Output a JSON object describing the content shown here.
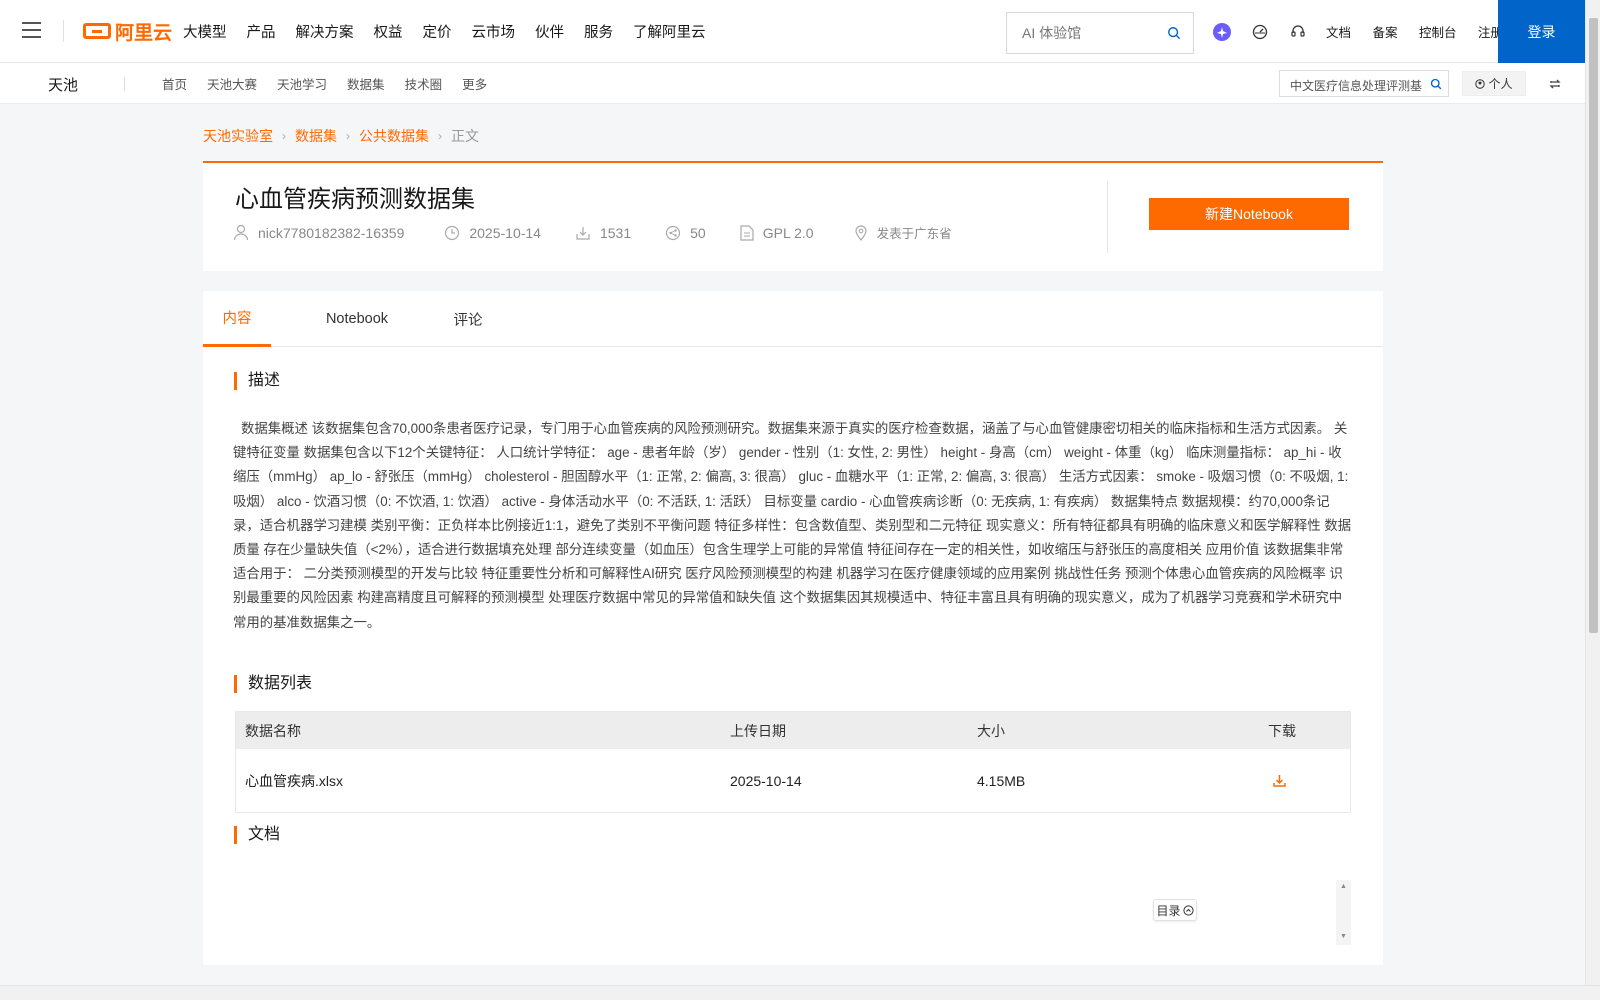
{
  "topnav": {
    "logo_text": "阿里云",
    "menu": [
      "大模型",
      "产品",
      "解决方案",
      "权益",
      "定价",
      "云市场",
      "伙伴",
      "服务",
      "了解阿里云"
    ],
    "search_placeholder": "AI 体验馆",
    "links": [
      "文档",
      "备案",
      "控制台",
      "注册"
    ],
    "login_label": "登录"
  },
  "subnav": {
    "brand": "天池",
    "menu": [
      "首页",
      "天池大赛",
      "天池学习",
      "数据集",
      "技术圈",
      "更多"
    ],
    "search_value": "中文医疗信息处理评测基",
    "personal_label": "个人"
  },
  "breadcrumb": {
    "items": [
      "天池实验室",
      "数据集",
      "公共数据集"
    ],
    "current": "正文"
  },
  "dataset": {
    "title": "心血管疾病预测数据集",
    "author": "nick7780182382-16359",
    "date": "2025-10-14",
    "downloads": "1531",
    "shares": "50",
    "license": "GPL 2.0",
    "location": "发表于广东省",
    "notebook_button": "新建Notebook"
  },
  "tabs": [
    "内容",
    "Notebook",
    "评论"
  ],
  "active_tab": "内容",
  "sections": {
    "description_title": "描述",
    "description_text": "数据集概述 该数据集包含70,000条患者医疗记录，专门用于心血管疾病的风险预测研究。数据集来源于真实的医疗检查数据，涵盖了与心血管健康密切相关的临床指标和生活方式因素。 关键特征变量 数据集包含以下12个关键特征： 人口统计学特征： age - 患者年龄（岁） gender - 性别（1: 女性, 2: 男性） height - 身高（cm） weight - 体重（kg） 临床测量指标： ap_hi - 收缩压（mmHg） ap_lo - 舒张压（mmHg） cholesterol - 胆固醇水平（1: 正常, 2: 偏高, 3: 很高） gluc - 血糖水平（1: 正常, 2: 偏高, 3: 很高） 生活方式因素： smoke - 吸烟习惯（0: 不吸烟, 1: 吸烟） alco - 饮酒习惯（0: 不饮酒, 1: 饮酒） active - 身体活动水平（0: 不活跃, 1: 活跃） 目标变量 cardio - 心血管疾病诊断（0: 无疾病, 1: 有疾病） 数据集特点 数据规模：约70,000条记录，适合机器学习建模 类别平衡：正负样本比例接近1:1，避免了类别不平衡问题 特征多样性：包含数值型、类别型和二元特征 现实意义：所有特征都具有明确的临床意义和医学解释性 数据质量 存在少量缺失值（<2%），适合进行数据填充处理 部分连续变量（如血压）包含生理学上可能的异常值 特征间存在一定的相关性，如收缩压与舒张压的高度相关 应用价值 该数据集非常适合用于： 二分类预测模型的开发与比较 特征重要性分析和可解释性AI研究 医疗风险预测模型的构建 机器学习在医疗健康领域的应用案例 挑战性任务 预测个体患心血管疾病的风险概率 识别最重要的风险因素 构建高精度且可解释的预测模型 处理医疗数据中常见的异常值和缺失值 这个数据集因其规模适中、特征丰富且具有明确的现实意义，成为了机器学习竞赛和学术研究中常用的基准数据集之一。",
    "datalist_title": "数据列表",
    "docs_title": "文档",
    "toc_label": "目录"
  },
  "table": {
    "headers": [
      "数据名称",
      "上传日期",
      "大小",
      "下载"
    ],
    "rows": [
      {
        "name": "心血管疾病.xlsx",
        "date": "2025-10-14",
        "size": "4.15MB"
      }
    ]
  },
  "colors": {
    "accent": "#ff6a00",
    "login_blue": "#0064c8"
  }
}
